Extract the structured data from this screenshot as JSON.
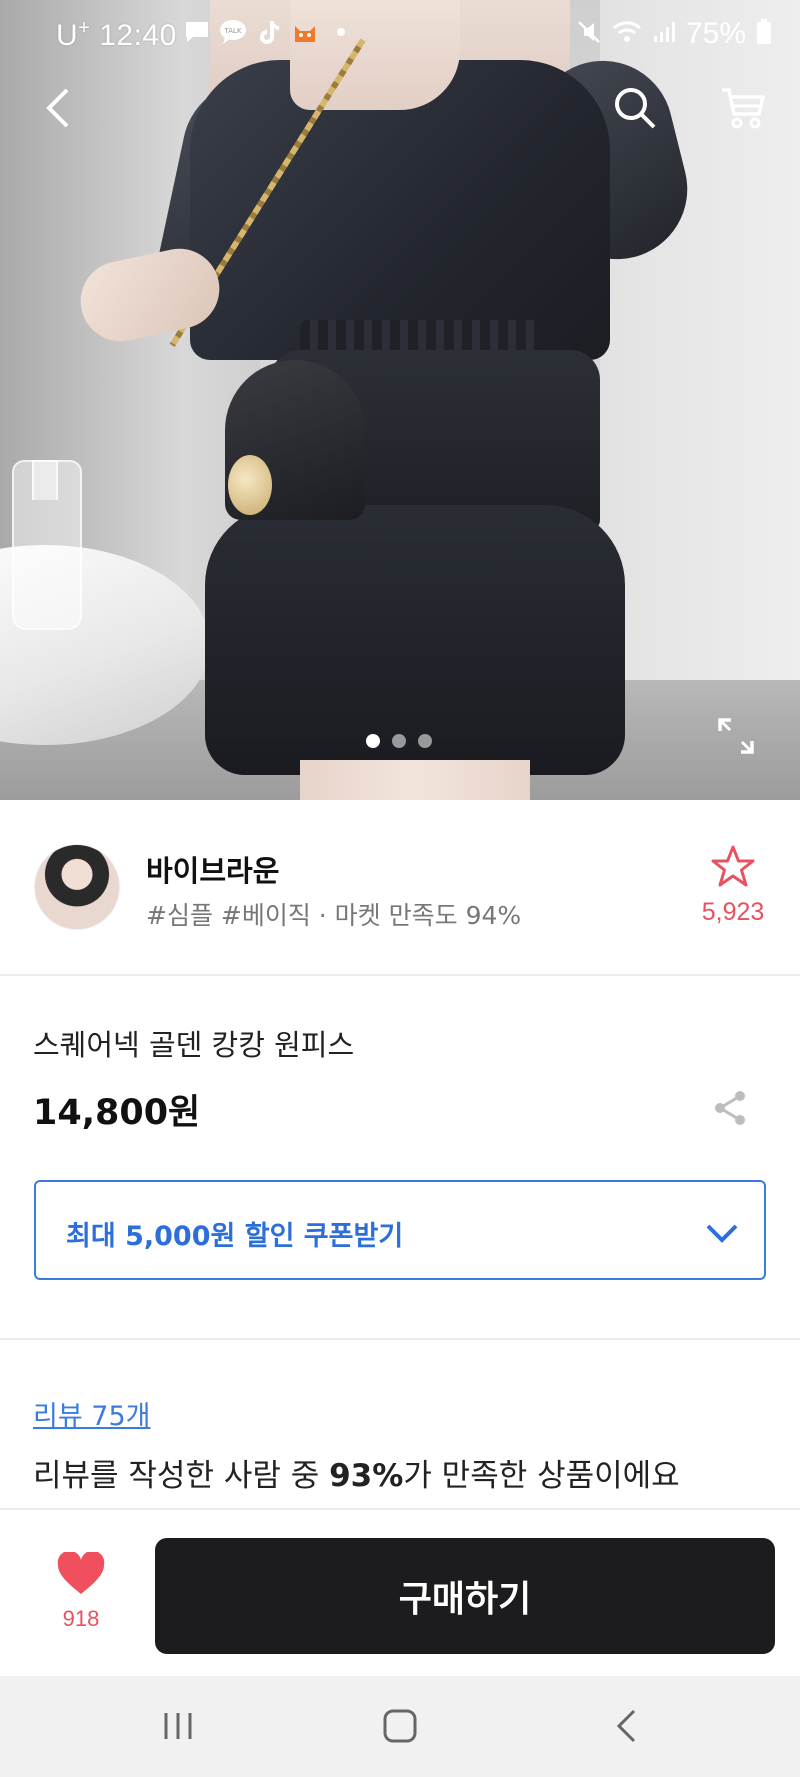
{
  "status_bar": {
    "carrier": "U",
    "carrier_sup": "+",
    "time": "12:40",
    "notification_icons": [
      "message-icon",
      "kakaotalk-icon",
      "tiktok-icon",
      "cat-app-icon",
      "dot-icon"
    ],
    "right_icons": [
      "mute-icon",
      "wifi-icon",
      "signal-icon",
      "battery-icon"
    ],
    "battery": "75%"
  },
  "hero": {
    "pager_total": 3,
    "pager_active": 1,
    "icons": [
      "back-icon",
      "search-icon",
      "cart-icon",
      "expand-icon"
    ]
  },
  "shop": {
    "name": "바이브라운",
    "tags": "#심플 #베이직 · 마켓 만족도 94%",
    "favorite_count": "5,923"
  },
  "product": {
    "title": "스퀘어넥 골덴 캉캉 원피스",
    "price": "14,800원",
    "coupon_label": "최대 5,000원 할인 쿠폰받기"
  },
  "reviews": {
    "link": "리뷰 75개",
    "summary_prefix": "리뷰를 작성한 사람 중 ",
    "summary_highlight": "93%",
    "summary_suffix": "가 만족한 상품이에요"
  },
  "buy_bar": {
    "like_count": "918",
    "buy_label": "구매하기"
  },
  "colors": {
    "accent_blue": "#3b7be0",
    "accent_red": "#e8515f",
    "buy_button": "#1c1c1e"
  }
}
